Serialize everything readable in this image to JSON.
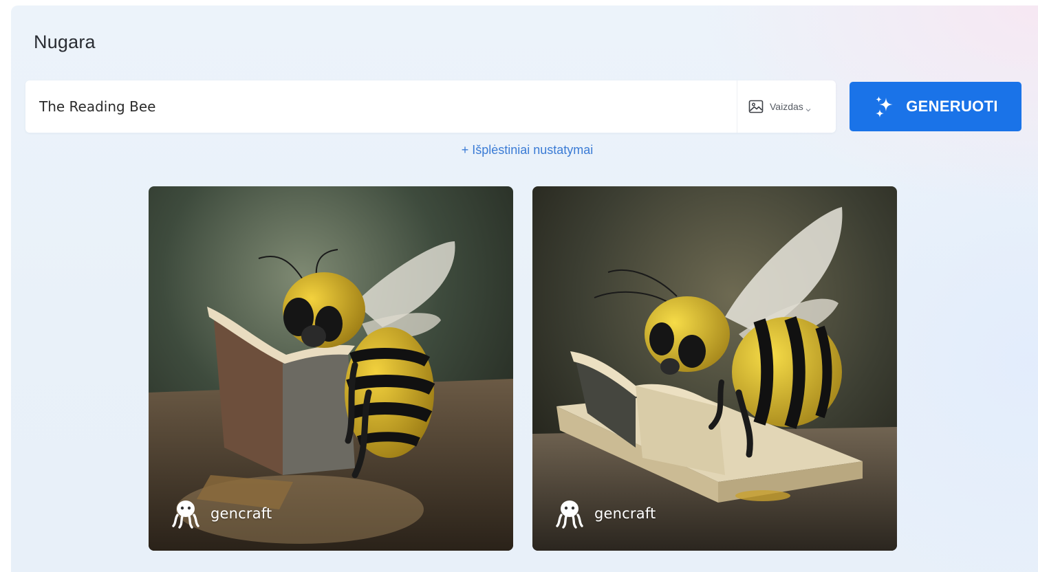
{
  "page": {
    "title": "Nugara"
  },
  "prompt": {
    "value": "The Reading Bee",
    "type_label": "Vaizdas",
    "type_icon": "image-icon"
  },
  "generate_button": {
    "label": "GENERUOTI",
    "icon": "sparkles-icon",
    "color": "#1a73e8"
  },
  "advanced_settings": {
    "label": "+ Išplėstiniai nustatymai"
  },
  "results": [
    {
      "description": "bee reading book",
      "watermark": "gencraft"
    },
    {
      "description": "bee reading book",
      "watermark": "gencraft"
    }
  ],
  "colors": {
    "accent": "#1a73e8",
    "link": "#3a7bd5"
  }
}
